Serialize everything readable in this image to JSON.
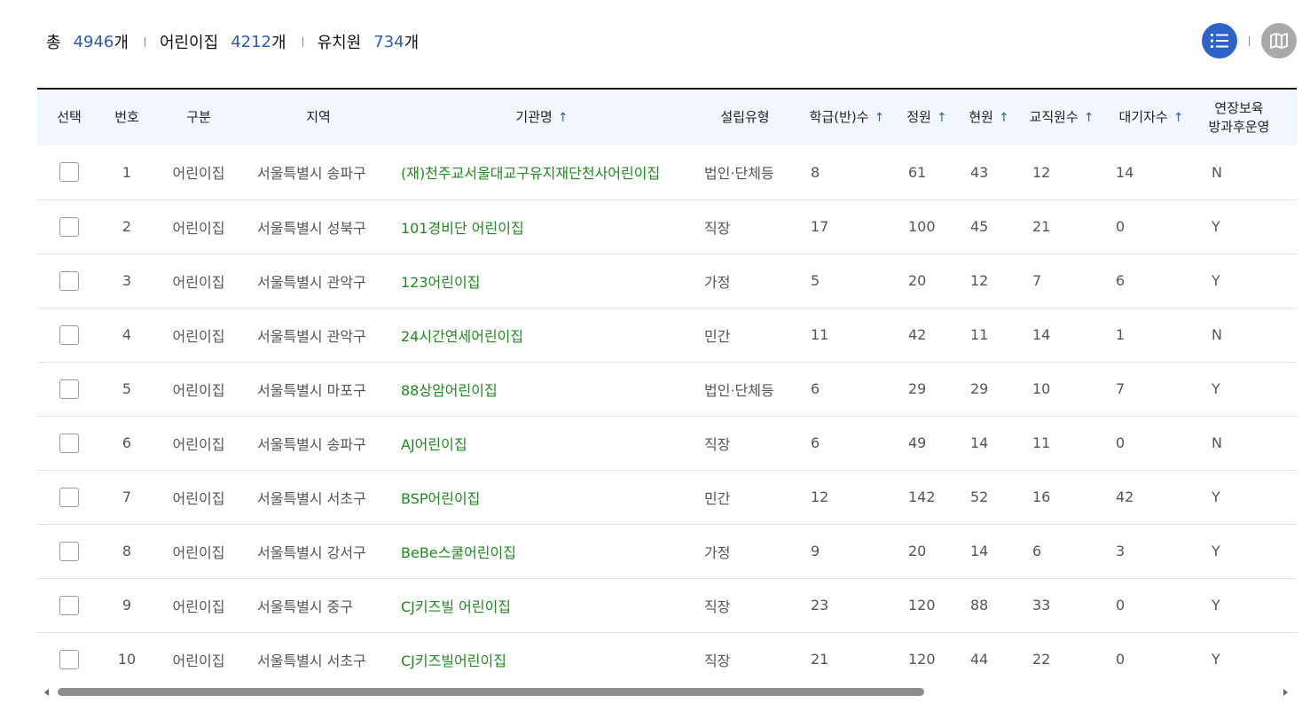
{
  "summary": {
    "total_label": "총",
    "total_count": "4946",
    "daycare_label": "어린이집",
    "daycare_count": "4212",
    "kinder_label": "유치원",
    "kinder_count": "734",
    "unit": "개"
  },
  "view": {
    "list_icon": "list-icon",
    "map_icon": "map-icon",
    "active": "list",
    "colors": {
      "active": "#2d63c8",
      "inactive": "#a9a9a9"
    }
  },
  "table": {
    "headers": {
      "select": "선택",
      "no": "번호",
      "type": "구분",
      "region": "지역",
      "name": "기관명",
      "founding": "설립유형",
      "classes": "학급(반)수",
      "capacity": "정원",
      "current": "현원",
      "staff": "교직원수",
      "waiting": "대기자수",
      "extended_line1": "연장보육",
      "extended_line2": "방과후운영",
      "sort_arrow": "↑"
    },
    "rows": [
      {
        "no": "1",
        "type": "어린이집",
        "region": "서울특별시 송파구",
        "name": "(재)천주교서울대교구유지재단천사어린이집",
        "founding": "법인·단체등",
        "classes": "8",
        "capacity": "61",
        "current": "43",
        "staff": "12",
        "waiting": "14",
        "extended": "N"
      },
      {
        "no": "2",
        "type": "어린이집",
        "region": "서울특별시 성북구",
        "name": "101경비단 어린이집",
        "founding": "직장",
        "classes": "17",
        "capacity": "100",
        "current": "45",
        "staff": "21",
        "waiting": "0",
        "extended": "Y"
      },
      {
        "no": "3",
        "type": "어린이집",
        "region": "서울특별시 관악구",
        "name": "123어린이집",
        "founding": "가정",
        "classes": "5",
        "capacity": "20",
        "current": "12",
        "staff": "7",
        "waiting": "6",
        "extended": "Y"
      },
      {
        "no": "4",
        "type": "어린이집",
        "region": "서울특별시 관악구",
        "name": "24시간연세어린이집",
        "founding": "민간",
        "classes": "11",
        "capacity": "42",
        "current": "11",
        "staff": "14",
        "waiting": "1",
        "extended": "N"
      },
      {
        "no": "5",
        "type": "어린이집",
        "region": "서울특별시 마포구",
        "name": "88상암어린이집",
        "founding": "법인·단체등",
        "classes": "6",
        "capacity": "29",
        "current": "29",
        "staff": "10",
        "waiting": "7",
        "extended": "Y"
      },
      {
        "no": "6",
        "type": "어린이집",
        "region": "서울특별시 송파구",
        "name": "AJ어린이집",
        "founding": "직장",
        "classes": "6",
        "capacity": "49",
        "current": "14",
        "staff": "11",
        "waiting": "0",
        "extended": "N"
      },
      {
        "no": "7",
        "type": "어린이집",
        "region": "서울특별시 서초구",
        "name": "BSP어린이집",
        "founding": "민간",
        "classes": "12",
        "capacity": "142",
        "current": "52",
        "staff": "16",
        "waiting": "42",
        "extended": "Y"
      },
      {
        "no": "8",
        "type": "어린이집",
        "region": "서울특별시 강서구",
        "name": "BeBe스쿨어린이집",
        "founding": "가정",
        "classes": "9",
        "capacity": "20",
        "current": "14",
        "staff": "6",
        "waiting": "3",
        "extended": "Y"
      },
      {
        "no": "9",
        "type": "어린이집",
        "region": "서울특별시 중구",
        "name": "CJ키즈빌 어린이집",
        "founding": "직장",
        "classes": "23",
        "capacity": "120",
        "current": "88",
        "staff": "33",
        "waiting": "0",
        "extended": "Y"
      },
      {
        "no": "10",
        "type": "어린이집",
        "region": "서울특별시 서초구",
        "name": "CJ키즈빌어린이집",
        "founding": "직장",
        "classes": "21",
        "capacity": "120",
        "current": "44",
        "staff": "22",
        "waiting": "0",
        "extended": "Y"
      }
    ]
  }
}
